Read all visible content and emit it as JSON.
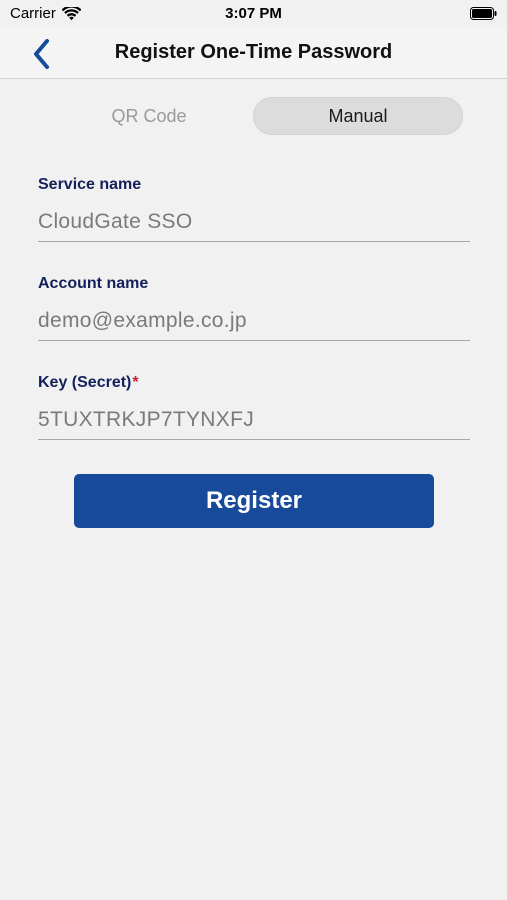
{
  "status_bar": {
    "carrier": "Carrier",
    "time": "3:07 PM"
  },
  "nav": {
    "title": "Register One-Time Password",
    "back_icon": "chevron-left-icon",
    "accent_color": "#174a9a"
  },
  "tabs": [
    {
      "label": "QR Code",
      "selected": false
    },
    {
      "label": "Manual",
      "selected": true
    }
  ],
  "form": {
    "service_name": {
      "label": "Service name",
      "value": "CloudGate SSO"
    },
    "account_name": {
      "label": "Account name",
      "value": "demo@example.co.jp"
    },
    "key_secret": {
      "label": "Key (Secret)",
      "required_mark": "*",
      "value": "5TUXTRKJP7TYNXFJ"
    }
  },
  "register_button": {
    "label": "Register",
    "color": "#174a9a"
  }
}
